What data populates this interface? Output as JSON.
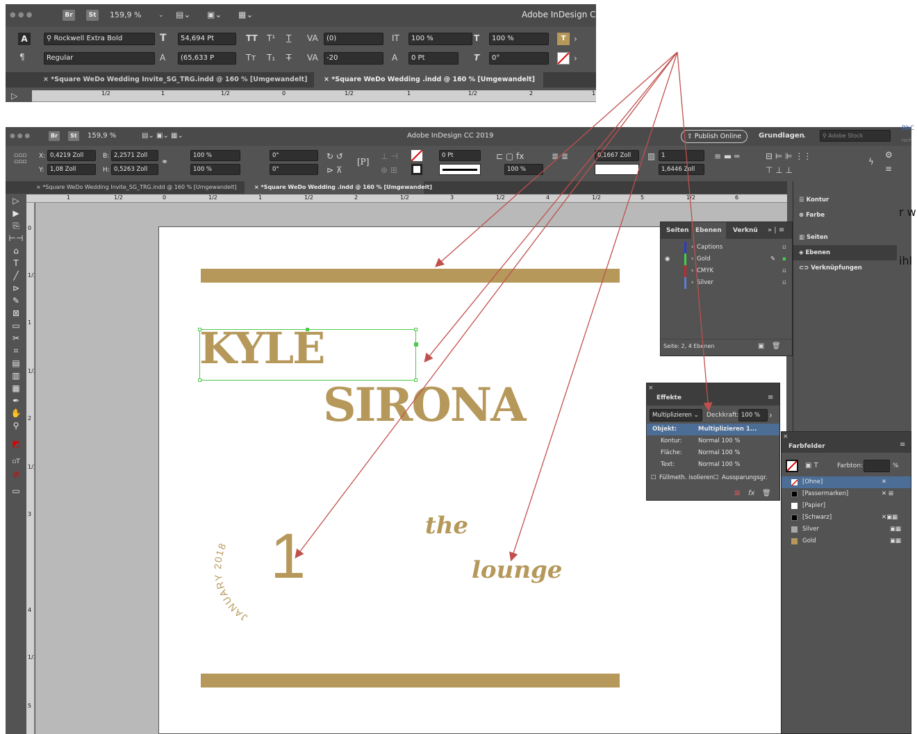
{
  "colors": {
    "gold": "#B5985A",
    "arrow": "#c0504d",
    "panel_bg": "#535353",
    "selected_row": "#4b6d96"
  },
  "top": {
    "app_title": "Adobe InDesign C",
    "zoom": "159,9 %",
    "br": "Br",
    "st": "St",
    "font": "Rockwell Extra Bold",
    "style": "Regular",
    "size": "54,694 Pt",
    "leading": "(65,633 P",
    "kerning": "(0)",
    "tracking": "-20",
    "vscale": "100 %",
    "hscale": "100 %",
    "baseline": "0 Pt",
    "skew": "0°",
    "tabs": [
      "*Square WeDo Wedding Invite_SG_TRG.indd @ 160 % [Umgewandelt]",
      "*Square WeDo Wedding .indd @ 160 % [Umgewandelt]"
    ],
    "ruler": [
      "1/2",
      "1",
      "1/2",
      "0",
      "1/2",
      "1",
      "1/2",
      "2",
      "1"
    ]
  },
  "main": {
    "app_title": "Adobe InDesign CC 2019",
    "zoom": "159,9 %",
    "br": "Br",
    "st": "St",
    "publish": "Publish Online",
    "workspace": "Grundlagen",
    "stock_placeholder": "Adobe Stock",
    "x": "0,4219 Zoll",
    "y": "1,08 Zoll",
    "w": "2,2571 Zoll",
    "h": "0,5263 Zoll",
    "xscale": "100 %",
    "yscale": "100 %",
    "rot": "0°",
    "shear": "0°",
    "stroke": "0 Pt",
    "opacity": "100 %",
    "gutter": "0,1667 Zoll",
    "cols": "1",
    "colwidth": "1,6446 Zoll",
    "tabs": [
      "*Square WeDo Wedding Invite_SG_TRG.indd @ 160 % [Umgewandelt]",
      "*Square WeDo Wedding .indd @ 160 % [Umgewandelt]"
    ],
    "ruler": [
      "1",
      "1/2",
      "0",
      "1/2",
      "1",
      "1/2",
      "2",
      "1/2",
      "3",
      "1/2",
      "4",
      "1/2",
      "5",
      "1/2",
      "6"
    ],
    "vruler": [
      "0",
      "1/2",
      "1",
      "1/2",
      "2",
      "1/2",
      "3",
      "4",
      "1/2",
      "5"
    ],
    "letter_p": "[P]"
  },
  "layers_panel": {
    "tabs": [
      "Seiten",
      "Ebenen",
      "Verknü"
    ],
    "layers": [
      {
        "name": "Captions",
        "color": "#2b3bd0"
      },
      {
        "name": "Gold",
        "color": "#3fd14a"
      },
      {
        "name": "CMYK",
        "color": "#c8262b"
      },
      {
        "name": "Silver",
        "color": "#5a7fd6"
      }
    ],
    "footer": "Seite: 2, 4 Ebenen"
  },
  "right_dock": {
    "items": [
      "Kontur",
      "Farbe",
      "Seiten",
      "Ebenen",
      "Verknüpfungen"
    ],
    "stray": [
      "r w",
      "ihl",
      "BbC",
      "rsch"
    ]
  },
  "effects_panel": {
    "title": "Effekte",
    "blend": "Multiplizieren",
    "opacity_label": "Deckkraft:",
    "opacity": "100 %",
    "rows": [
      {
        "label": "Objekt:",
        "value": "Multiplizieren 1..."
      },
      {
        "label": "Kontur:",
        "value": "Normal 100 %"
      },
      {
        "label": "Fläche:",
        "value": "Normal 100 %"
      },
      {
        "label": "Text:",
        "value": "Normal 100 %"
      }
    ],
    "check1": "Füllmeth. isolieren",
    "check2": "Aussparungsgr."
  },
  "swatches_panel": {
    "title": "Farbfelder",
    "tint_label": "Farbton:",
    "tint_unit": "%",
    "swatches": [
      {
        "name": "[Ohne]",
        "color": "none"
      },
      {
        "name": "[Passermarken]",
        "color": "#000000"
      },
      {
        "name": "[Papier]",
        "color": "#ffffff"
      },
      {
        "name": "[Schwarz]",
        "color": "#000000"
      },
      {
        "name": "Silver",
        "color": "#a8a8a8"
      },
      {
        "name": "Gold",
        "color": "#B5985A"
      }
    ]
  },
  "document": {
    "name1": "KYLE",
    "name2": "SIRONA",
    "the": "the",
    "lounge": "lounge",
    "date_number": "1",
    "date_text": "JANUARY 2018"
  }
}
